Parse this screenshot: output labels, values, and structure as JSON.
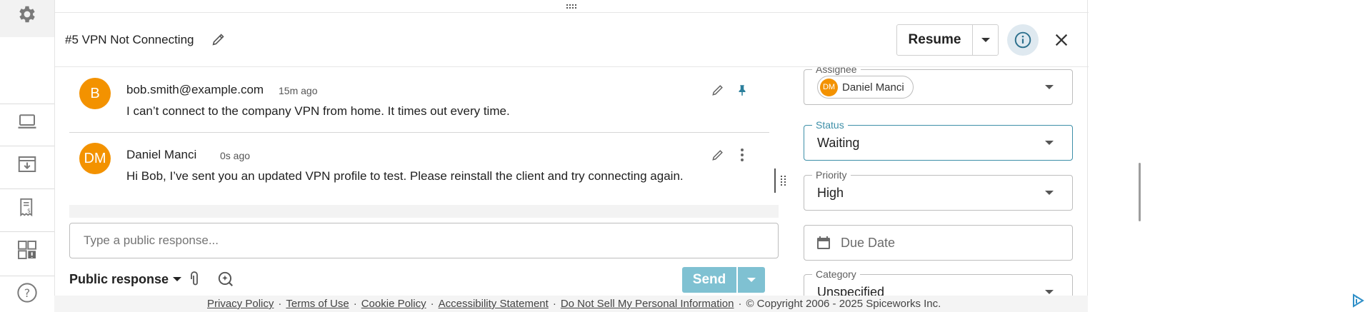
{
  "colors": {
    "accent": "#3d8fa8",
    "avatar": "#f39200",
    "send": "#7fc1d2",
    "info_bg": "#dfe9f0"
  },
  "rail": {
    "icons": [
      "gear-icon",
      "laptop-icon",
      "download-tray-icon",
      "invoice-icon",
      "dashboard-alert-icon",
      "help-icon"
    ]
  },
  "ticket": {
    "title": "#5 VPN Not Connecting",
    "resume_label": "Resume"
  },
  "messages": [
    {
      "initials": "B",
      "author": "bob.smith@example.com",
      "time": "15m ago",
      "body": "I can’t connect to the company VPN from home. It times out every time."
    },
    {
      "initials": "DM",
      "author": "Daniel Manci",
      "time": "0s ago",
      "body": "Hi Bob, I’ve sent you an updated VPN profile to test. Please reinstall the client and try connecting again."
    }
  ],
  "compose": {
    "placeholder": "Type a public response...",
    "mode_label": "Public response",
    "send_label": "Send"
  },
  "fields": {
    "assignee": {
      "label": "Assignee",
      "initials": "DM",
      "value": "Daniel Manci"
    },
    "status": {
      "label": "Status",
      "value": "Waiting"
    },
    "priority": {
      "label": "Priority",
      "value": "High"
    },
    "due_date": {
      "placeholder": "Due Date"
    },
    "category": {
      "label": "Category",
      "value": "Unspecified"
    }
  },
  "footer": {
    "links": [
      "Privacy Policy",
      "Terms of Use",
      "Cookie Policy",
      "Accessibility Statement",
      "Do Not Sell My Personal Information"
    ],
    "copyright": "© Copyright 2006 - 2025 Spiceworks Inc."
  }
}
